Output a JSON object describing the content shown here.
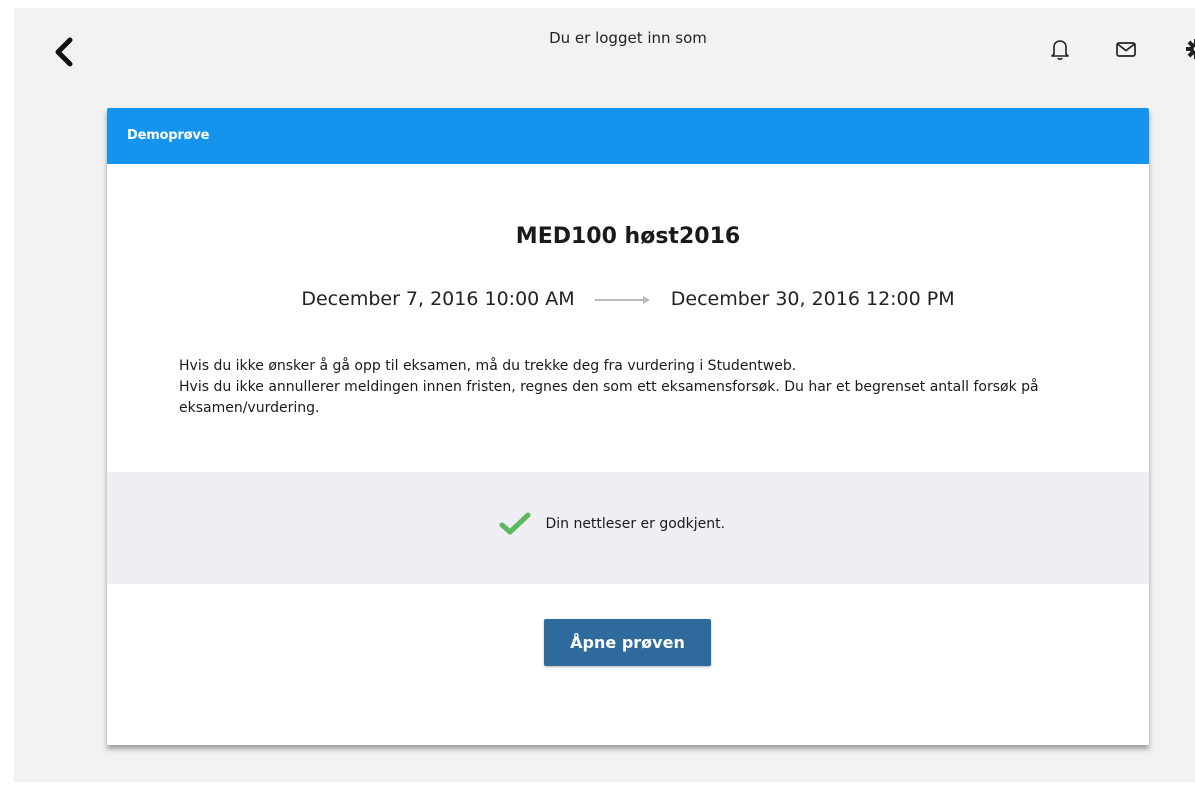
{
  "topbar": {
    "title": "Du er logget inn som",
    "icons": [
      "back-chevron-icon",
      "bell-icon",
      "mail-icon",
      "gear-icon"
    ]
  },
  "card": {
    "header_label": "Demoprøve",
    "exam_title": "MED100 høst2016",
    "start_date": "December 7, 2016 10:00 AM",
    "end_date": "December 30, 2016 12:00 PM",
    "info_lines": [
      "Hvis du ikke ønsker å gå opp til eksamen, må du trekke deg fra vurdering i Studentweb.",
      "Hvis du ikke annullerer meldingen innen fristen, regnes den som ett eksamensforsøk. Du har et begrenset antall forsøk på eksamen/vurdering."
    ],
    "status_text": "Din nettleser er godkjent.",
    "open_button_label": "Åpne prøven"
  },
  "colors": {
    "header_blue": "#1594ee",
    "button_blue": "#2e6b9c",
    "check_green": "#5cb85c",
    "status_band": "#eeeef3"
  }
}
